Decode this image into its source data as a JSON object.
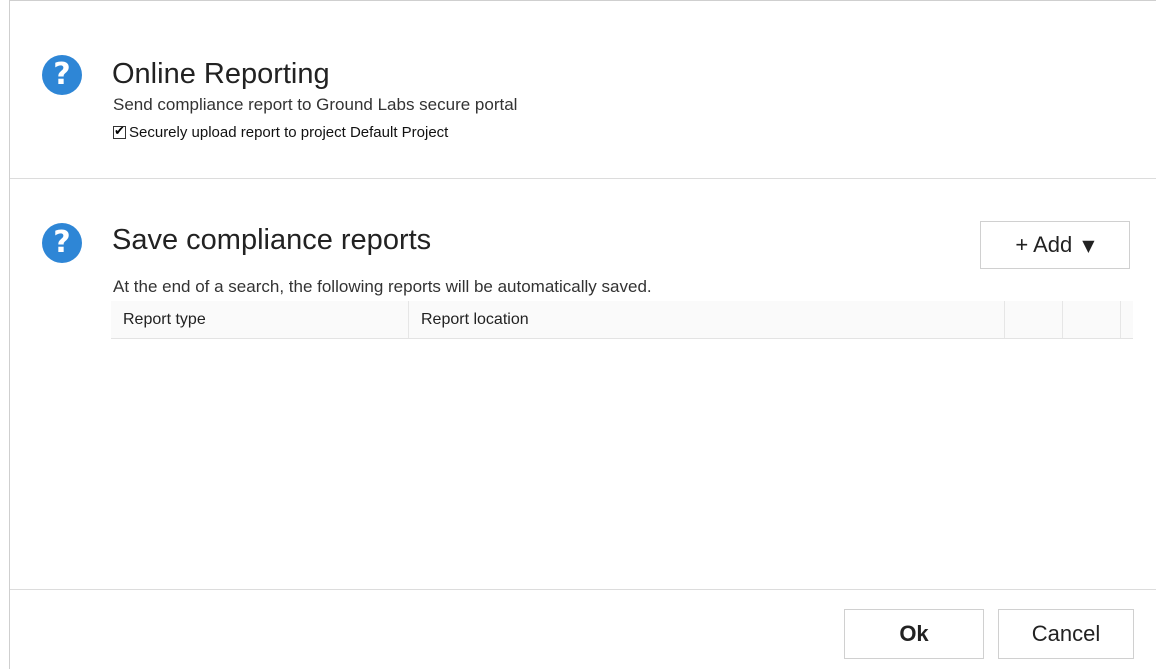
{
  "online_reporting": {
    "help_icon_glyph": "?",
    "title": "Online Reporting",
    "subtitle": "Send compliance report to Ground Labs secure portal",
    "upload_checkbox": {
      "checked": true,
      "label": "Securely upload report to project Default Project"
    }
  },
  "save_reports": {
    "help_icon_glyph": "?",
    "title": "Save compliance reports",
    "subtitle": "At the end of a search, the following reports will be automatically saved.",
    "add_button": {
      "label": "+ Add",
      "caret": "▼"
    },
    "table": {
      "columns": [
        "Report type",
        "Report location"
      ],
      "rows": []
    }
  },
  "footer": {
    "ok_label": "Ok",
    "cancel_label": "Cancel"
  },
  "colors": {
    "help_icon": "#2e86d6",
    "border": "#d0d0d0"
  },
  "icons": {
    "help": "help-circle-icon",
    "check": "checkmark-icon",
    "caret": "caret-down-icon"
  }
}
